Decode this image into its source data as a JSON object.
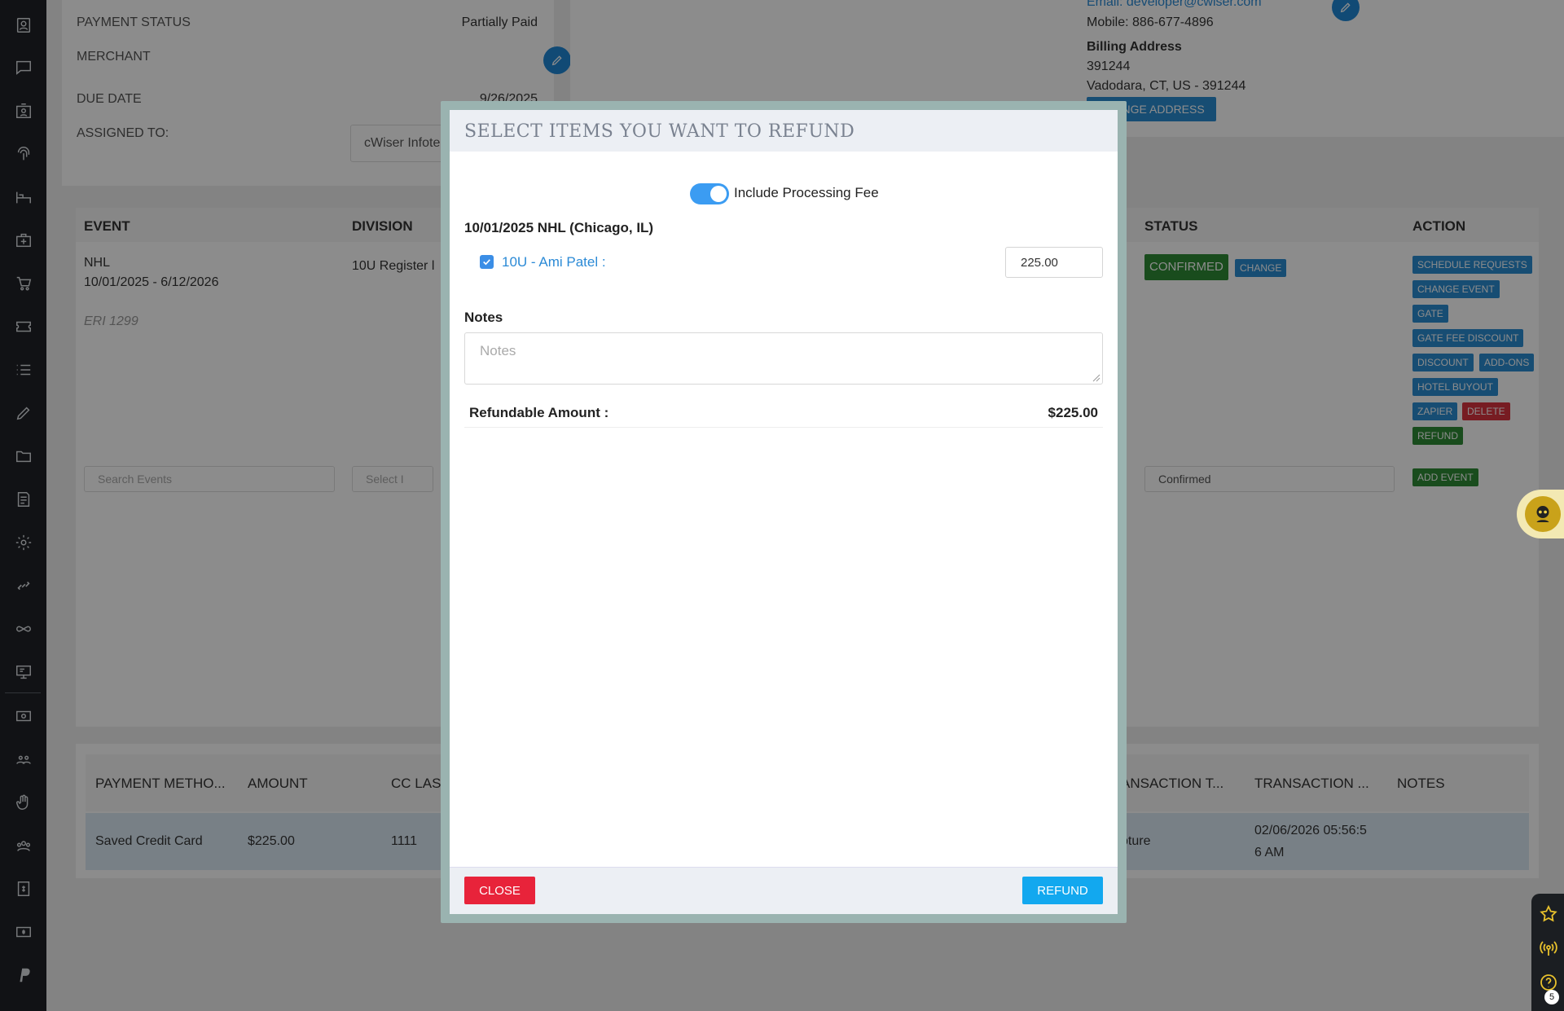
{
  "background": {
    "info": {
      "payment_status_label": "PAYMENT STATUS",
      "payment_status_value": "Partially Paid",
      "merchant_label": "MERCHANT",
      "due_date_label": "DUE DATE",
      "due_date_value": "9/26/2025",
      "assigned_label": "ASSIGNED TO:",
      "assigned_value": "cWiser Infotech"
    },
    "contact": {
      "email": "Email: developer@cwiser.com",
      "mobile": "Mobile: 886-677-4896",
      "billing_title": "Billing Address",
      "billing_line1": "391244",
      "billing_line2": "Vadodara, CT, US - 391244",
      "change_address": "CHANGE ADDRESS"
    },
    "events_table": {
      "headers": {
        "event": "EVENT",
        "division": "DIVISION",
        "status": "STATUS",
        "action": "ACTION"
      },
      "row": {
        "event_name": "NHL",
        "event_dates": "10/01/2025 - 6/12/2026",
        "eri": "ERI 1299",
        "division": "10U Register l",
        "status": "CONFIRMED",
        "change": "CHANGE"
      },
      "actions": {
        "schedule_requests": "SCHEDULE REQUESTS",
        "change_event": "CHANGE EVENT",
        "gate": "GATE",
        "gate_fee_discount": "GATE FEE DISCOUNT",
        "discount": "DISCOUNT",
        "add_ons": "ADD-ONS",
        "hotel_buyout": "HOTEL BUYOUT",
        "zapier": "ZAPIER",
        "delete": "DELETE",
        "refund": "REFUND",
        "add_event": "ADD EVENT"
      },
      "filters": {
        "search_placeholder": "Search Events",
        "select_placeholder": "Select I",
        "status_value": "Confirmed"
      }
    },
    "payments_table": {
      "headers": {
        "method": "PAYMENT METHO...",
        "amount": "AMOUNT",
        "cc_last": "CC LAS",
        "transaction_type": "ANSACTION T...",
        "transaction_date": "TRANSACTION ...",
        "notes": "NOTES"
      },
      "row": {
        "method": "Saved Credit Card",
        "amount": "$225.00",
        "cc_last": "1111",
        "transaction_type": "pture",
        "transaction_date_line1": "02/06/2026 05:56:5",
        "transaction_date_line2": "6 AM"
      }
    }
  },
  "modal": {
    "title": "SELECT ITEMS YOU WANT TO REFUND",
    "toggle_label": "Include Processing Fee",
    "event_heading": "10/01/2025 NHL (Chicago, IL)",
    "item_label": "10U - Ami Patel :",
    "item_amount": "225.00",
    "notes_label": "Notes",
    "notes_placeholder": "Notes",
    "refundable_label": "Refundable Amount :",
    "refundable_value": "$225.00",
    "close_label": "CLOSE",
    "refund_label": "REFUND"
  },
  "dock": {
    "badge": "5"
  },
  "colors": {
    "accent_blue": "#12a8ef",
    "danger_red": "#e8233a",
    "toggle_blue": "#3b9cf2",
    "confirmed_green": "#2e8b36"
  }
}
